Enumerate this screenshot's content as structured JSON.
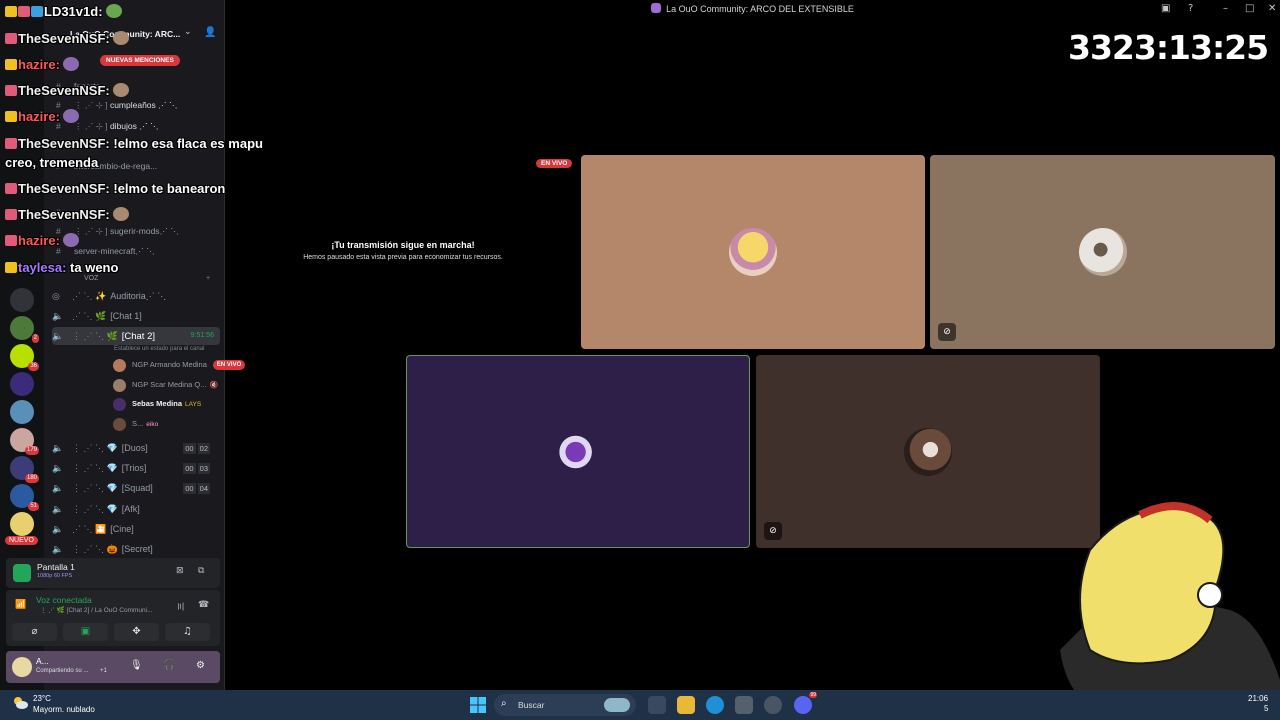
{
  "window": {
    "title": "La OuO Community: ARCO DEL EXTENSIBLE",
    "controls": [
      "inbox-icon",
      "help-icon",
      "minimize-icon",
      "maximize-icon",
      "close-icon"
    ]
  },
  "server_rail": {
    "badges": [
      "2",
      "36",
      "179",
      "180",
      "51"
    ],
    "new_label": "NUEVO"
  },
  "sidebar": {
    "guild_name": "La OuO Community: ARC...",
    "mentions_label": "NUEVAS MENCIONES",
    "text_channels": [
      {
        "prefix": "",
        "name": "fanarts"
      },
      {
        "prefix": "⋮ ⋰ ⊹ ]",
        "name": "cumpleaños ⋰ ⋱"
      },
      {
        "prefix": "⋮ ⋰ ⊹ ]",
        "name": "dibujos ⋰ ⋱"
      },
      {
        "prefix": "",
        "name": "intercambio-de-rega..."
      },
      {
        "prefix": "",
        "name": "⋰ ⋱"
      },
      {
        "prefix": "⋮ ⋰ ⊹ ]",
        "name": "sugerir-mods⋰ ⋱"
      },
      {
        "prefix": "",
        "name": "server-minecraft⋰ ⋱"
      }
    ],
    "voice_category": "VOZ",
    "voice_channels": [
      {
        "prefix": "⋰ ⋱ ✨",
        "name": "Auditoria⋰ ⋱",
        "count": ""
      },
      {
        "prefix": "⋰ ⋱ 🌿",
        "name": "[Chat 1]",
        "count": ""
      },
      {
        "prefix": "⋮ ⋰ ⋱ 🌿",
        "name": "[Chat 2]",
        "count": "",
        "time": "9:51:56"
      },
      {
        "prefix": "⋮ ⋰ ⋱ 💎",
        "name": "[Duos]",
        "count_a": "00",
        "count_b": "02"
      },
      {
        "prefix": "⋮ ⋰ ⋱ 💎",
        "name": "[Trios]",
        "count_a": "00",
        "count_b": "03"
      },
      {
        "prefix": "⋮ ⋰ ⋱ 💎",
        "name": "[Squad]",
        "count_a": "00",
        "count_b": "04"
      },
      {
        "prefix": "⋮ ⋰ ⋱ 💎",
        "name": "[Afk]",
        "count": ""
      },
      {
        "prefix": "⋰ ⋱ 🎦",
        "name": "[Cine]",
        "count": ""
      },
      {
        "prefix": "⋮ ⋰ ⋱ 🎃",
        "name": "[Secret]",
        "count": ""
      }
    ],
    "channel_status": "Establece un estado para el canal",
    "voice_users": [
      {
        "name": "NGP Armando Medina",
        "live": "EN VIVO"
      },
      {
        "name": "NGP Scar Medina Q...",
        "live": ""
      },
      {
        "name": "Sebas Medina",
        "tag": "LAYS"
      },
      {
        "name": "S...",
        "tag": "eiko"
      }
    ]
  },
  "screen_share": {
    "name": "Pantalla 1",
    "quality": "1080p 60 FPS"
  },
  "voice_panel": {
    "status": "Voz conectada",
    "location": "⋮ ⋰ 🌿 [Chat 2] / La OuO Communi..."
  },
  "user_panel": {
    "name": "A...",
    "sub": "Compartiendo su ...",
    "extra": "+1"
  },
  "stage": {
    "timer": "3323:13:25",
    "live_badge": "EN VIVO",
    "paused_title": "¡Tu transmisión sigue en marcha!",
    "paused_desc": "Hemos pausado esta vista previa para economizar tus recursos.",
    "tiles": [
      {
        "name": "tile-1",
        "bg": "#b5876a"
      },
      {
        "name": "tile-2",
        "bg": "#8a7460"
      },
      {
        "name": "tile-3",
        "bg": "#2d1f47"
      },
      {
        "name": "tile-4",
        "bg": "#3f302b"
      }
    ]
  },
  "chat_overlay": {
    "header": "LD31v1d:",
    "lines": [
      {
        "user": "TheSevenNSF:",
        "text": "",
        "style": "u1"
      },
      {
        "user": "hazire:",
        "text": "",
        "style": "u2"
      },
      {
        "user": "TheSevenNSF:",
        "text": "",
        "style": "u1"
      },
      {
        "user": "hazire:",
        "text": "",
        "style": "u2"
      },
      {
        "user": "TheSevenNSF:",
        "text": "!elmo esa flaca es mapu",
        "style": "u1"
      },
      {
        "user": "",
        "text": "creo, tremenda",
        "style": "u1"
      },
      {
        "user": "TheSevenNSF:",
        "text": "!elmo te banearon",
        "style": "u1"
      },
      {
        "user": "TheSevenNSF:",
        "text": "",
        "style": "u1"
      },
      {
        "user": "hazire:",
        "text": "",
        "style": "u2"
      },
      {
        "user": "taylesa:",
        "text": "ta weno",
        "style": "u3"
      }
    ]
  },
  "taskbar": {
    "temp": "23°C",
    "weather": "Mayorm. nublado",
    "search_placeholder": "Buscar",
    "time": "21:06",
    "date_frag": "5",
    "discord_badge": "99"
  },
  "colors": {
    "accent_green": "#23a55a",
    "badge_red": "#da373c",
    "sidebar_bg": "#1a1a1e"
  }
}
